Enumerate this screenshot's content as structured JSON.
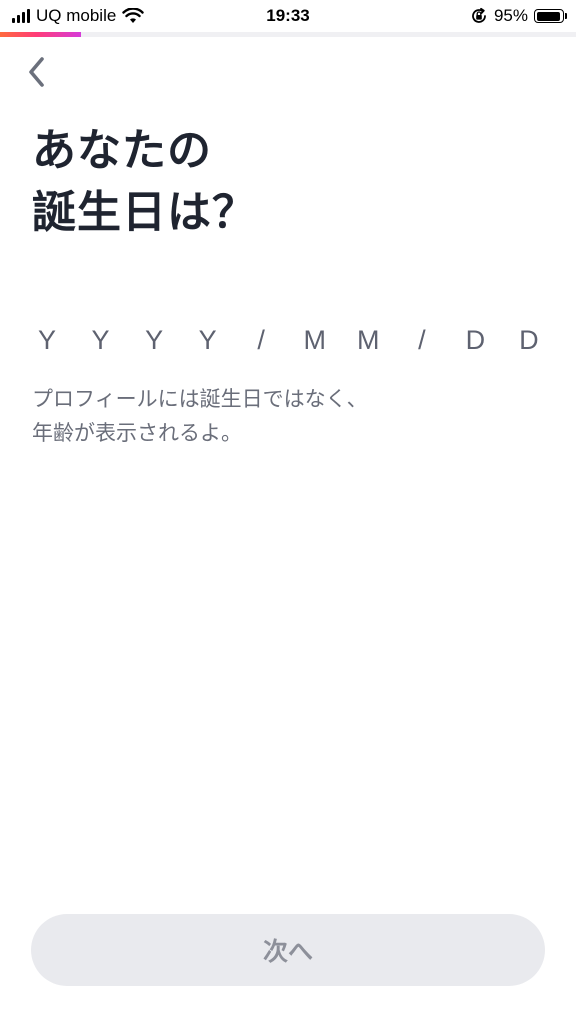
{
  "status_bar": {
    "carrier": "UQ mobile",
    "time": "19:33",
    "battery_percent": "95%",
    "battery_level": 0.95,
    "icons": [
      "signal-icon",
      "wifi-icon",
      "orientation-lock-icon",
      "battery-icon"
    ]
  },
  "progress": {
    "fraction": 0.14,
    "colors": [
      "#ff6a3d",
      "#ff3c78",
      "#d63bd9"
    ]
  },
  "header": {
    "back_icon": "chevron-left-icon",
    "title_lines": [
      "あなたの",
      "誕生日は？"
    ]
  },
  "birthday_input": {
    "placeholder_chars": [
      "Y",
      "Y",
      "Y",
      "Y",
      "/",
      "M",
      "M",
      "/",
      "D",
      "D"
    ]
  },
  "helper_lines": [
    "プロフィールには誕生日ではなく、",
    "年齢が表示されるよ。"
  ],
  "footer": {
    "next_label": "次へ"
  },
  "colors": {
    "title": "#1f2430",
    "button_bg": "#e9eaee",
    "button_text": "#8d909a"
  }
}
